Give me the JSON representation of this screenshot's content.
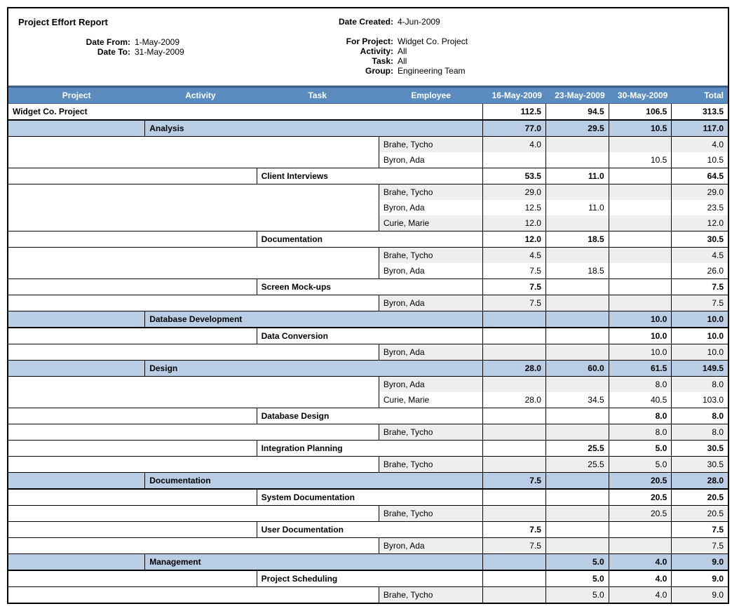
{
  "report_title": "Project Effort Report",
  "header_left": {
    "date_from_label": "Date From:",
    "date_from": "1-May-2009",
    "date_to_label": "Date To:",
    "date_to": "31-May-2009"
  },
  "header_right": {
    "date_created_label": "Date Created:",
    "date_created": "4-Jun-2009",
    "for_project_label": "For Project:",
    "for_project": "Widget Co. Project",
    "activity_label": "Activity:",
    "activity": "All",
    "task_label": "Task:",
    "task": "All",
    "group_label": "Group:",
    "group": "Engineering Team"
  },
  "columns": {
    "project": "Project",
    "activity": "Activity",
    "task": "Task",
    "employee": "Employee",
    "d1": "16-May-2009",
    "d2": "23-May-2009",
    "d3": "30-May-2009",
    "total": "Total"
  },
  "rows": [
    {
      "type": "project",
      "project": "Widget Co. Project",
      "d1": "112.5",
      "d2": "94.5",
      "d3": "106.5",
      "total": "313.5"
    },
    {
      "type": "activity",
      "activity": "Analysis",
      "d1": "77.0",
      "d2": "29.5",
      "d3": "10.5",
      "total": "117.0"
    },
    {
      "type": "emp",
      "alt": true,
      "emp": "Brahe, Tycho",
      "d1": "4.0",
      "d2": "",
      "d3": "",
      "total": "4.0"
    },
    {
      "type": "emp",
      "emp": "Byron, Ada",
      "d1": "",
      "d2": "",
      "d3": "10.5",
      "total": "10.5"
    },
    {
      "type": "task",
      "task": "Client Interviews",
      "d1": "53.5",
      "d2": "11.0",
      "d3": "",
      "total": "64.5"
    },
    {
      "type": "emp",
      "alt": true,
      "emp": "Brahe, Tycho",
      "d1": "29.0",
      "d2": "",
      "d3": "",
      "total": "29.0"
    },
    {
      "type": "emp",
      "emp": "Byron, Ada",
      "d1": "12.5",
      "d2": "11.0",
      "d3": "",
      "total": "23.5"
    },
    {
      "type": "emp",
      "alt": true,
      "emp": "Curie, Marie",
      "d1": "12.0",
      "d2": "",
      "d3": "",
      "total": "12.0"
    },
    {
      "type": "task",
      "task": "Documentation",
      "d1": "12.0",
      "d2": "18.5",
      "d3": "",
      "total": "30.5"
    },
    {
      "type": "emp",
      "alt": true,
      "emp": "Brahe, Tycho",
      "d1": "4.5",
      "d2": "",
      "d3": "",
      "total": "4.5"
    },
    {
      "type": "emp",
      "emp": "Byron, Ada",
      "d1": "7.5",
      "d2": "18.5",
      "d3": "",
      "total": "26.0"
    },
    {
      "type": "task",
      "task": "Screen Mock-ups",
      "d1": "7.5",
      "d2": "",
      "d3": "",
      "total": "7.5"
    },
    {
      "type": "emp",
      "alt": true,
      "emp": "Byron, Ada",
      "d1": "7.5",
      "d2": "",
      "d3": "",
      "total": "7.5"
    },
    {
      "type": "activity",
      "activity": "Database Development",
      "d1": "",
      "d2": "",
      "d3": "10.0",
      "total": "10.0"
    },
    {
      "type": "task",
      "task": "Data Conversion",
      "d1": "",
      "d2": "",
      "d3": "10.0",
      "total": "10.0"
    },
    {
      "type": "emp",
      "alt": true,
      "emp": "Byron, Ada",
      "d1": "",
      "d2": "",
      "d3": "10.0",
      "total": "10.0"
    },
    {
      "type": "activity",
      "activity": "Design",
      "d1": "28.0",
      "d2": "60.0",
      "d3": "61.5",
      "total": "149.5"
    },
    {
      "type": "emp",
      "alt": true,
      "emp": "Byron, Ada",
      "d1": "",
      "d2": "",
      "d3": "8.0",
      "total": "8.0"
    },
    {
      "type": "emp",
      "emp": "Curie, Marie",
      "d1": "28.0",
      "d2": "34.5",
      "d3": "40.5",
      "total": "103.0"
    },
    {
      "type": "task",
      "task": "Database Design",
      "d1": "",
      "d2": "",
      "d3": "8.0",
      "total": "8.0"
    },
    {
      "type": "emp",
      "alt": true,
      "emp": "Brahe, Tycho",
      "d1": "",
      "d2": "",
      "d3": "8.0",
      "total": "8.0"
    },
    {
      "type": "task",
      "task": "Integration Planning",
      "d1": "",
      "d2": "25.5",
      "d3": "5.0",
      "total": "30.5"
    },
    {
      "type": "emp",
      "alt": true,
      "emp": "Brahe, Tycho",
      "d1": "",
      "d2": "25.5",
      "d3": "5.0",
      "total": "30.5"
    },
    {
      "type": "activity",
      "activity": "Documentation",
      "d1": "7.5",
      "d2": "",
      "d3": "20.5",
      "total": "28.0"
    },
    {
      "type": "task",
      "task": "System Documentation",
      "d1": "",
      "d2": "",
      "d3": "20.5",
      "total": "20.5"
    },
    {
      "type": "emp",
      "alt": true,
      "emp": "Brahe, Tycho",
      "d1": "",
      "d2": "",
      "d3": "20.5",
      "total": "20.5"
    },
    {
      "type": "task",
      "task": "User Documentation",
      "d1": "7.5",
      "d2": "",
      "d3": "",
      "total": "7.5"
    },
    {
      "type": "emp",
      "alt": true,
      "emp": "Byron, Ada",
      "d1": "7.5",
      "d2": "",
      "d3": "",
      "total": "7.5"
    },
    {
      "type": "activity",
      "activity": "Management",
      "d1": "",
      "d2": "5.0",
      "d3": "4.0",
      "total": "9.0"
    },
    {
      "type": "task",
      "task": "Project Scheduling",
      "d1": "",
      "d2": "5.0",
      "d3": "4.0",
      "total": "9.0"
    },
    {
      "type": "emp",
      "alt": true,
      "emp": "Brahe, Tycho",
      "d1": "",
      "d2": "5.0",
      "d3": "4.0",
      "total": "9.0"
    }
  ]
}
